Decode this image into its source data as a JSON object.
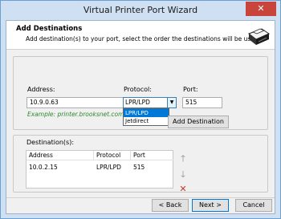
{
  "window": {
    "title": "Virtual Printer Port Wizard",
    "close_glyph": "✕"
  },
  "header": {
    "title": "Add Destinations",
    "subtitle": "Add destination(s) to your port, select the order the destinations will be used."
  },
  "form": {
    "address_label": "Address:",
    "address_value": "10.9.0.63",
    "example": "Example: printer.brooksnet.com",
    "protocol_label": "Protocol:",
    "protocol_value": "LPR/LPD",
    "protocol_options": [
      "LPR/LPD",
      "Jetdirect"
    ],
    "port_label": "Port:",
    "port_value": "515",
    "add_button": "Add Destination"
  },
  "destinations": {
    "label": "Destination(s):",
    "columns": [
      "Address",
      "Protocol",
      "Port"
    ],
    "rows": [
      {
        "address": "10.0.2.15",
        "protocol": "LPR/LPD",
        "port": "515"
      }
    ]
  },
  "footer": {
    "back": "< Back",
    "next": "Next >",
    "cancel": "Cancel"
  },
  "icons": [
    "printer-icon",
    "up-arrow-icon",
    "down-arrow-icon",
    "delete-icon"
  ]
}
